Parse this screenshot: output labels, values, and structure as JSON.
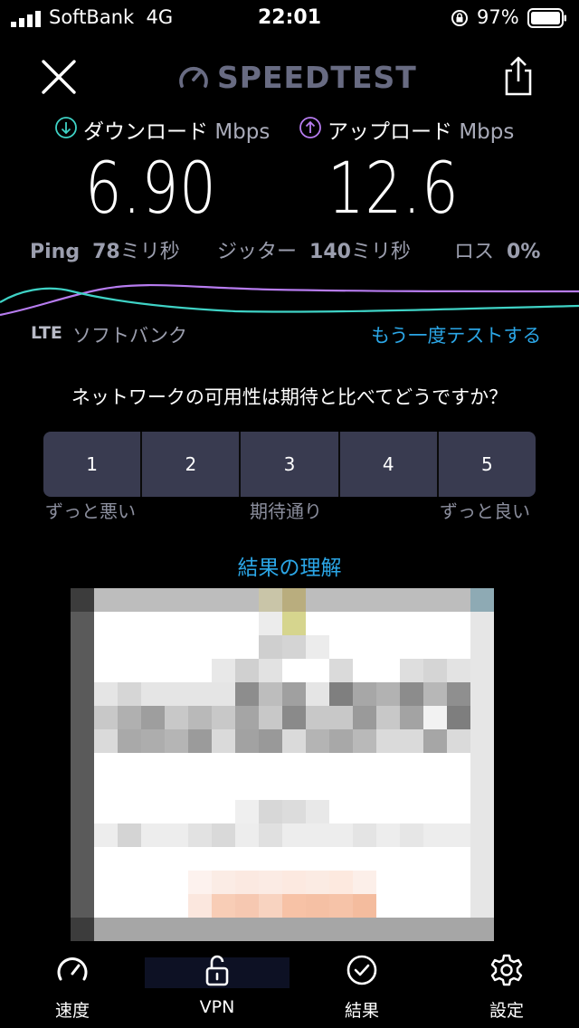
{
  "status_bar": {
    "carrier": "SoftBank",
    "network": "4G",
    "time": "22:01",
    "battery": "97%"
  },
  "header": {
    "logo": "SPEEDTEST"
  },
  "download": {
    "label": "ダウンロード",
    "unit": "Mbps",
    "value": "6.90"
  },
  "upload": {
    "label": "アップロード",
    "unit": "Mbps",
    "value": "12.6"
  },
  "metrics": {
    "ping_label": "Ping",
    "ping_value": "78",
    "ping_unit": "ミリ秒",
    "jitter_label": "ジッター",
    "jitter_value": "140",
    "jitter_unit": "ミリ秒",
    "loss_label": "ロス",
    "loss_value": "0%"
  },
  "connection": {
    "type": "LTE",
    "provider": "ソフトバンク",
    "retest": "もう一度テストする"
  },
  "survey": {
    "question": "ネットワークの可用性は期待と比べてどうですか？",
    "options": [
      "1",
      "2",
      "3",
      "4",
      "5"
    ],
    "low": "ずっと悪い",
    "mid": "期待通り",
    "high": "ずっと良い"
  },
  "understand_link": "結果の理解",
  "tabs": [
    {
      "label": "速度"
    },
    {
      "label": "VPN"
    },
    {
      "label": "結果"
    },
    {
      "label": "設定"
    }
  ],
  "colors": {
    "accent_blue": "#2ba6e6",
    "download": "#3fd3c6",
    "upload": "#b77cf0",
    "button": "#393b50"
  }
}
